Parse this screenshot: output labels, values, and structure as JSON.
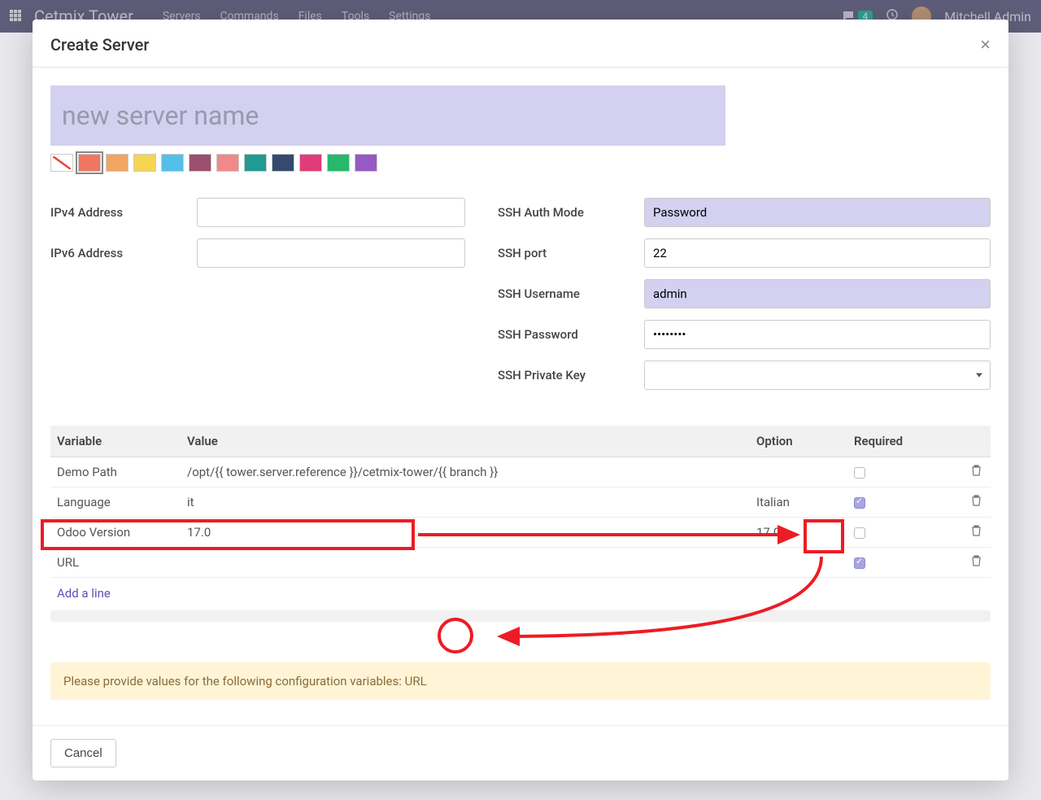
{
  "topbar": {
    "brand": "Cetmix Tower",
    "nav": [
      "Servers",
      "Commands",
      "Files",
      "Tools",
      "Settings"
    ],
    "msg_count": "4",
    "user": "Mitchell Admin"
  },
  "modal": {
    "title": "Create Server",
    "name_placeholder": "new server name",
    "colors": [
      "#ef7661",
      "#f0a561",
      "#f4d652",
      "#54bfe8",
      "#9b4f6e",
      "#ef8a8a",
      "#209b91",
      "#344a6f",
      "#e23b7a",
      "#26b86b",
      "#9759c5"
    ],
    "left": {
      "ipv4_label": "IPv4 Address",
      "ipv6_label": "IPv6 Address"
    },
    "right": {
      "auth_label": "SSH Auth Mode",
      "auth_value": "Password",
      "port_label": "SSH port",
      "port_value": "22",
      "user_label": "SSH Username",
      "user_value": "admin",
      "pass_label": "SSH Password",
      "pass_value": "••••••••",
      "key_label": "SSH Private Key"
    },
    "table": {
      "headers": {
        "variable": "Variable",
        "value": "Value",
        "option": "Option",
        "required": "Required"
      },
      "rows": [
        {
          "variable": "Demo Path",
          "value": "/opt/{{ tower.server.reference }}/cetmix-tower/{{ branch }}",
          "option": "",
          "required": false
        },
        {
          "variable": "Language",
          "value": "it",
          "option": "Italian",
          "required": true
        },
        {
          "variable": "Odoo Version",
          "value": "17.0",
          "option": "17.0",
          "required": false
        },
        {
          "variable": "URL",
          "value": "",
          "option": "",
          "required": true
        }
      ],
      "add_line": "Add a line"
    },
    "warning_prefix": "Please provide values for the following configuration variables: ",
    "warning_var": "URL",
    "cancel": "Cancel"
  }
}
